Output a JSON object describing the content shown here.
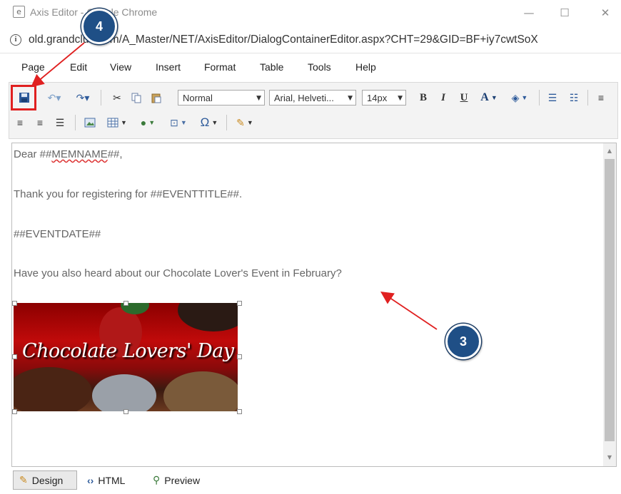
{
  "window": {
    "title": "Axis Editor - Google Chrome",
    "minimize_glyph": "—",
    "maximize_glyph": "☐",
    "close_glyph": "✕"
  },
  "address_bar": {
    "url": "old.grandclub.com/A_Master/NET/AxisEditor/DialogContainerEditor.aspx?CHT=29&GID=BF+iy7cwtSoX"
  },
  "menu": {
    "items": [
      "Page",
      "Edit",
      "View",
      "Insert",
      "Format",
      "Table",
      "Tools",
      "Help"
    ]
  },
  "toolbar": {
    "paragraph_format": "Normal",
    "font_family": "Arial, Helveti...",
    "font_size": "14px",
    "bold": "B",
    "italic": "I",
    "underline": "U",
    "font_color": "A",
    "special_char": "Ω",
    "icons": [
      "save-icon",
      "undo-icon",
      "redo-icon",
      "cut-icon",
      "copy-icon",
      "paste-icon",
      "bold-icon",
      "italic-icon",
      "underline-icon",
      "font-color-icon",
      "highlight-icon",
      "ordered-list-icon",
      "unordered-list-icon",
      "align-left-icon",
      "align-center-icon",
      "align-right-icon",
      "justify-icon",
      "image-manager-icon",
      "table-icon",
      "hyperlink-icon",
      "template-icon",
      "special-character-icon",
      "format-stripper-icon"
    ]
  },
  "editor": {
    "greeting_prefix": "Dear ##",
    "greeting_token": "MEMNAME",
    "greeting_suffix": "##,",
    "line_2": "Thank you for registering for ##EVENTTITLE##.",
    "line_3": "##EVENTDATE##",
    "line_4": "Have you also heard about our Chocolate Lover's Event in February?",
    "image_caption": "Chocolate Lovers' Day"
  },
  "bottom_tabs": [
    {
      "label": "Design",
      "active": true
    },
    {
      "label": "HTML",
      "active": false
    },
    {
      "label": "Preview",
      "active": false
    }
  ],
  "annotations": {
    "step_3": "3",
    "step_4": "4",
    "callout_color": "#1f4f86",
    "arrow_color": "#e02020"
  }
}
